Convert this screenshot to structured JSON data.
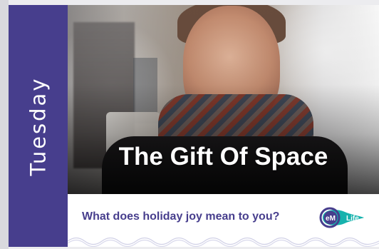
{
  "card": {
    "day": "Tuesday",
    "title": "The Gift Of Space",
    "question": "What does holiday joy mean to you?",
    "brand": {
      "logo_text": "eM",
      "logo_suffix": "Life"
    }
  },
  "colors": {
    "accent_purple": "#473e8d",
    "white": "#ffffff",
    "logo_teal": "#16b2ad"
  },
  "icons": {
    "brand_logo": "em-life-logo-icon"
  }
}
